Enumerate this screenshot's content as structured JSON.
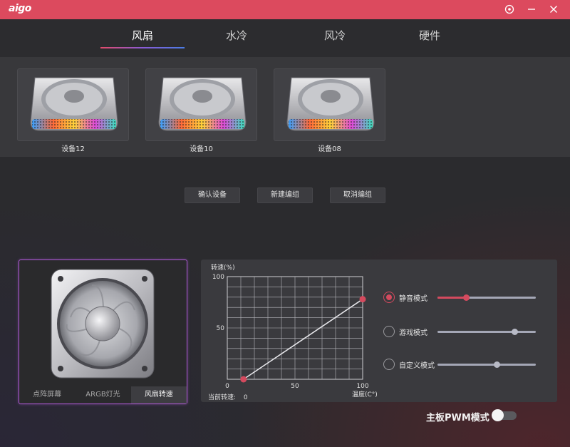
{
  "app": {
    "logo": "aigo"
  },
  "tabs": [
    {
      "label": "风扇",
      "active": true
    },
    {
      "label": "水冷",
      "active": false
    },
    {
      "label": "风冷",
      "active": false
    },
    {
      "label": "硬件",
      "active": false
    }
  ],
  "devices": [
    {
      "label": "设备12"
    },
    {
      "label": "设备10"
    },
    {
      "label": "设备08"
    }
  ],
  "actions": {
    "confirm": "确认设备",
    "new_group": "新建编组",
    "cancel_group": "取消编组"
  },
  "fan_panel": {
    "tabs": [
      {
        "label": "点阵屏幕",
        "active": false
      },
      {
        "label": "ARGB灯光",
        "active": false
      },
      {
        "label": "风扇转速",
        "active": true
      }
    ]
  },
  "chart_data": {
    "type": "line",
    "ylabel": "转速(%)",
    "xlabel": "温度(C°)",
    "xlim": [
      0,
      100
    ],
    "ylim": [
      0,
      100
    ],
    "xticks": [
      "0",
      "50",
      "100"
    ],
    "yticks": [
      "50",
      "100"
    ],
    "grid": true,
    "series": [
      {
        "x": [
          12,
          100
        ],
        "y": [
          0,
          78
        ]
      }
    ]
  },
  "current_speed": {
    "label": "当前转速:",
    "value": "0"
  },
  "modes": [
    {
      "label": "静音模式",
      "checked": true,
      "level": 0.29
    },
    {
      "label": "游戏模式",
      "checked": false,
      "level": 0.78
    },
    {
      "label": "自定义模式",
      "checked": false,
      "level": 0.6
    }
  ],
  "pwm": {
    "label": "主板PWM模式",
    "on": false
  },
  "colors": {
    "accent": "#dc4a5e",
    "panel_border": "#b05ad8"
  }
}
